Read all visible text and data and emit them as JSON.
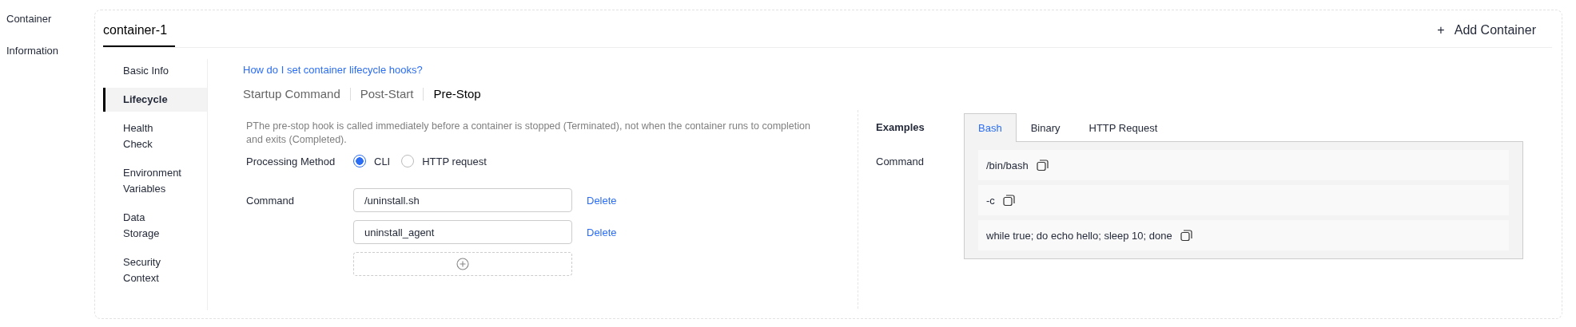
{
  "section_label": "Container Information",
  "container_tabs": [
    {
      "label": "container-1",
      "selected": true
    }
  ],
  "add_container": {
    "icon": "+",
    "label": "Add Container"
  },
  "side_nav": [
    {
      "label": "Basic Info",
      "selected": false
    },
    {
      "label": "Lifecycle",
      "selected": true
    },
    {
      "label": "Health Check",
      "selected": false
    },
    {
      "label": "Environment Variables",
      "selected": false
    },
    {
      "label": "Data Storage",
      "selected": false
    },
    {
      "label": "Security Context",
      "selected": false
    }
  ],
  "help_link": "How do I set container lifecycle hooks?",
  "hook_tabs": [
    {
      "label": "Startup Command",
      "selected": false
    },
    {
      "label": "Post-Start",
      "selected": false
    },
    {
      "label": "Pre-Stop",
      "selected": true
    }
  ],
  "description": "PThe pre-stop hook is called immediately before a container is stopped (Terminated), not when the container runs to completion and exits (Completed).",
  "processing_method": {
    "label": "Processing Method",
    "options": [
      {
        "label": "CLI",
        "selected": true
      },
      {
        "label": "HTTP request",
        "selected": false
      }
    ]
  },
  "command": {
    "label": "Command",
    "entries": [
      {
        "value": "/uninstall.sh",
        "action": "Delete"
      },
      {
        "value": "uninstall_agent",
        "action": "Delete"
      }
    ]
  },
  "examples": {
    "title": "Examples",
    "tabs": [
      {
        "label": "Bash",
        "selected": true
      },
      {
        "label": "Binary",
        "selected": false
      },
      {
        "label": "HTTP Request",
        "selected": false
      }
    ],
    "command_label": "Command",
    "lines": [
      "/bin/bash",
      "-c",
      "while true; do echo hello; sleep 10; done"
    ]
  }
}
